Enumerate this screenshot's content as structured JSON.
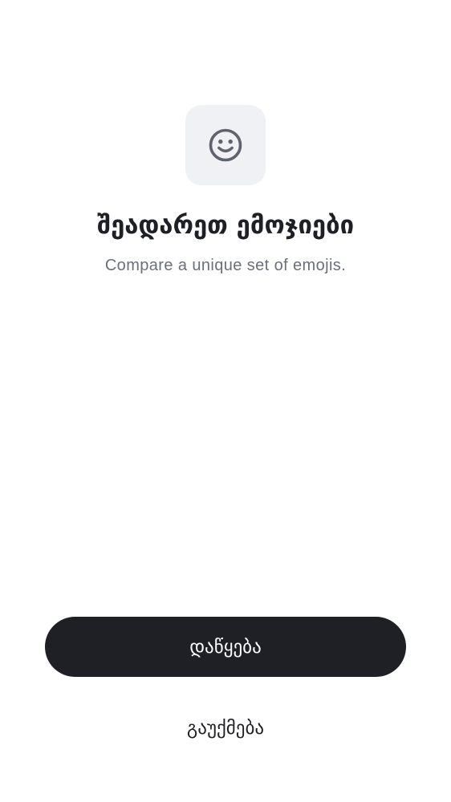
{
  "intro": {
    "icon": "smiley-face-icon",
    "title": "შეადარეთ ემოჯიები",
    "subtitle": "Compare a unique set of emojis."
  },
  "actions": {
    "start_label": "დაწყება",
    "cancel_label": "გაუქმება"
  },
  "colors": {
    "background": "#ffffff",
    "icon_tile": "#f0f1f4",
    "icon": "#5f636d",
    "title": "#1f2025",
    "subtitle": "#6b6f78",
    "primary_button": "#1f2026",
    "primary_button_text": "#ffffff"
  }
}
